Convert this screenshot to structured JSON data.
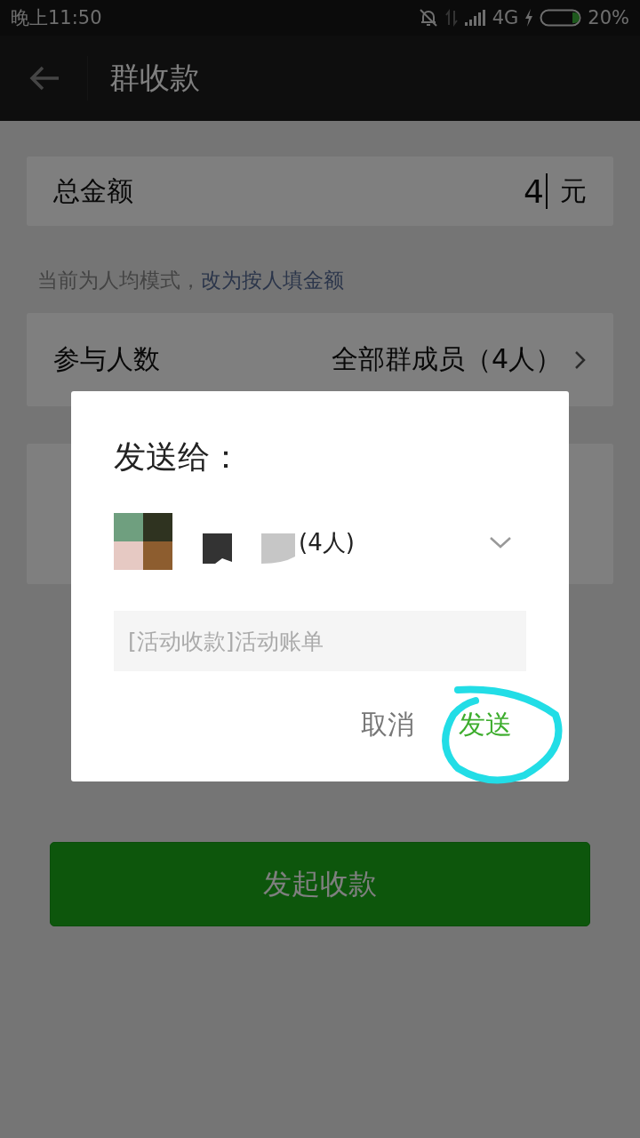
{
  "status_bar": {
    "time": "晚上11:50",
    "network": "4G",
    "battery": "20%"
  },
  "nav": {
    "title": "群收款"
  },
  "total": {
    "label": "总金额",
    "value": "4",
    "unit": "元"
  },
  "hint": {
    "text": "当前为人均模式，",
    "link": "改为按人填金额"
  },
  "participants": {
    "label": "参与人数",
    "value": "全部群成员（4人）"
  },
  "submit_button": "发起收款",
  "dialog": {
    "title": "发送给：",
    "recipient_count": "(4人)",
    "message_placeholder": "[活动收款]活动账单",
    "buttons": [
      {
        "label": "取消",
        "kind": "cancel"
      },
      {
        "label": "发送",
        "kind": "confirm"
      }
    ]
  }
}
